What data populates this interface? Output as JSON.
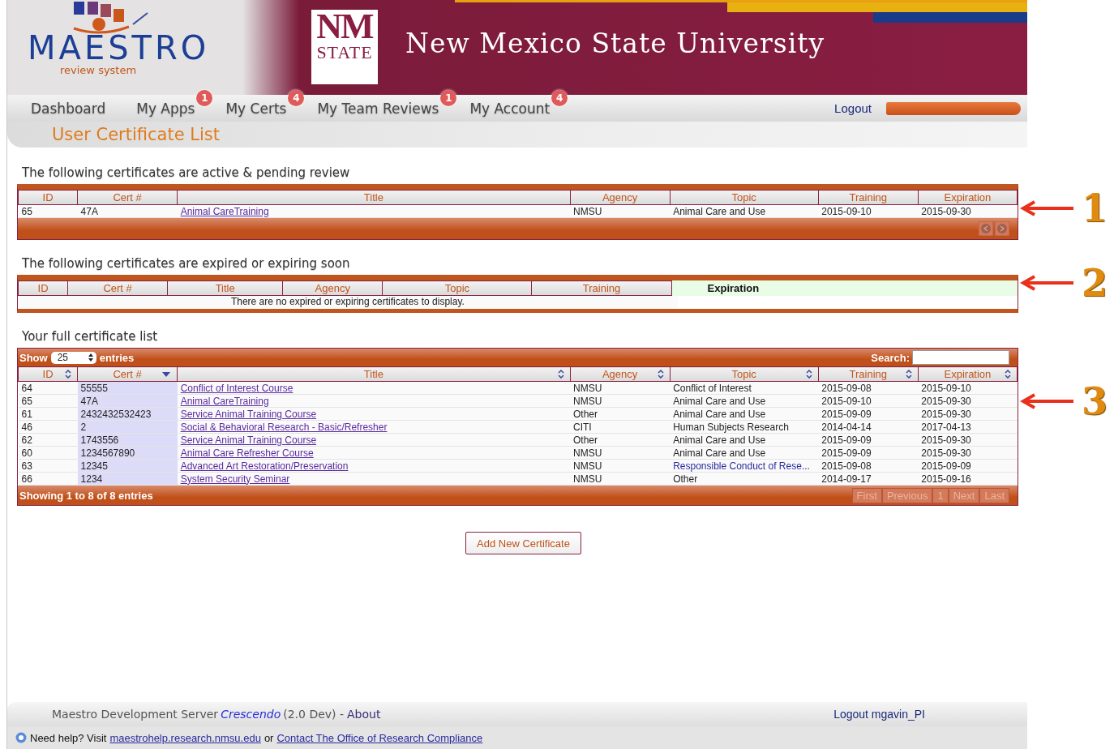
{
  "logo": {
    "name": "MAESTRO",
    "tagline": "review system"
  },
  "university": {
    "mark_top": "NM",
    "mark_bottom": "STATE",
    "name": "New Mexico State University"
  },
  "nav": [
    {
      "label": "Dashboard"
    },
    {
      "label": "My Apps",
      "badge": "1"
    },
    {
      "label": "My Certs",
      "badge": "4"
    },
    {
      "label": "My Team Reviews",
      "badge": "1"
    },
    {
      "label": "My Account",
      "badge": "4"
    }
  ],
  "logout": "Logout",
  "page_title": "User Certificate List",
  "active": {
    "heading": "The following certificates are active & pending review",
    "columns": [
      "ID",
      "Cert #",
      "Title",
      "Agency",
      "Topic",
      "Training",
      "Expiration"
    ],
    "rows": [
      [
        "65",
        "47A",
        "Animal CareTraining",
        "NMSU",
        "Animal Care and Use",
        "2015-09-10",
        "2015-09-30"
      ]
    ]
  },
  "expiring": {
    "heading": "The following certificates are expired or expiring soon",
    "columns": [
      {
        "label": "ID",
        "highlighted": false
      },
      {
        "label": "Cert #",
        "highlighted": false
      },
      {
        "label": "Title",
        "highlighted": false
      },
      {
        "label": "Agency",
        "highlighted": false
      },
      {
        "label": "Topic",
        "highlighted": false
      },
      {
        "label": "Training",
        "highlighted": false
      },
      {
        "label": "Expiration",
        "highlighted": true
      }
    ],
    "empty": "There are no expired or expiring certificates to display."
  },
  "full": {
    "heading": "Your full certificate list",
    "show": "Show",
    "page_size": "25",
    "entries": "entries",
    "search_label": "Search:",
    "columns": [
      {
        "label": "ID",
        "sorted": false
      },
      {
        "label": "Cert #",
        "sorted": true
      },
      {
        "label": "Title",
        "sorted": false
      },
      {
        "label": "Agency",
        "sorted": false
      },
      {
        "label": "Topic",
        "sorted": false
      },
      {
        "label": "Training",
        "sorted": false
      },
      {
        "label": "Expiration",
        "sorted": false
      }
    ],
    "rows": [
      {
        "id": "64",
        "cert": "55555",
        "title": "Conflict of Interest Course",
        "agency": "NMSU",
        "topic": "Conflict of Interest",
        "topic_link": false,
        "training": "2015-09-08",
        "expiration": "2015-09-10"
      },
      {
        "id": "65",
        "cert": "47A",
        "title": "Animal CareTraining",
        "agency": "NMSU",
        "topic": "Animal Care and Use",
        "topic_link": false,
        "training": "2015-09-10",
        "expiration": "2015-09-30"
      },
      {
        "id": "61",
        "cert": "2432432532423",
        "title": "Service Animal Training Course",
        "agency": "Other",
        "topic": "Animal Care and Use",
        "topic_link": false,
        "training": "2015-09-09",
        "expiration": "2015-09-30"
      },
      {
        "id": "46",
        "cert": "2",
        "title": "Social & Behavioral Research - Basic/Refresher",
        "agency": "CITI",
        "topic": "Human Subjects Research",
        "topic_link": false,
        "training": "2014-04-14",
        "expiration": "2017-04-13"
      },
      {
        "id": "62",
        "cert": "1743556",
        "title": "Service Animal Training Course",
        "agency": "Other",
        "topic": "Animal Care and Use",
        "topic_link": false,
        "training": "2015-09-09",
        "expiration": "2015-09-30"
      },
      {
        "id": "60",
        "cert": "1234567890",
        "title": "Animal Care Refresher Course",
        "agency": "NMSU",
        "topic": "Animal Care and Use",
        "topic_link": false,
        "training": "2015-09-09",
        "expiration": "2015-09-30"
      },
      {
        "id": "63",
        "cert": "12345",
        "title": "Advanced Art Restoration/Preservation",
        "agency": "NMSU",
        "topic": "Responsible Conduct of Rese...",
        "topic_link": true,
        "training": "2015-09-08",
        "expiration": "2015-09-09"
      },
      {
        "id": "66",
        "cert": "1234",
        "title": "System Security Seminar",
        "agency": "NMSU",
        "topic": "Other",
        "topic_link": false,
        "training": "2014-09-17",
        "expiration": "2015-09-16"
      }
    ],
    "info": "Showing 1 to 8 of 8 entries",
    "pager": [
      {
        "label": "First"
      },
      {
        "label": "Previous"
      },
      {
        "label": "1"
      },
      {
        "label": "Next"
      },
      {
        "label": "Last"
      }
    ]
  },
  "add_button": "Add New Certificate",
  "callouts": [
    "1",
    "2",
    "3"
  ],
  "footer": {
    "server": "Maestro Development Server",
    "release": "Crescendo",
    "version": "(2.0 Dev) -",
    "about": "About",
    "logout_user": "Logout mgavin_PI"
  },
  "help": {
    "lead": "Need help?  Visit",
    "site": "maestrohelp.research.nmsu.edu",
    "or": "or",
    "contact": "Contact The Office of Research Compliance"
  }
}
